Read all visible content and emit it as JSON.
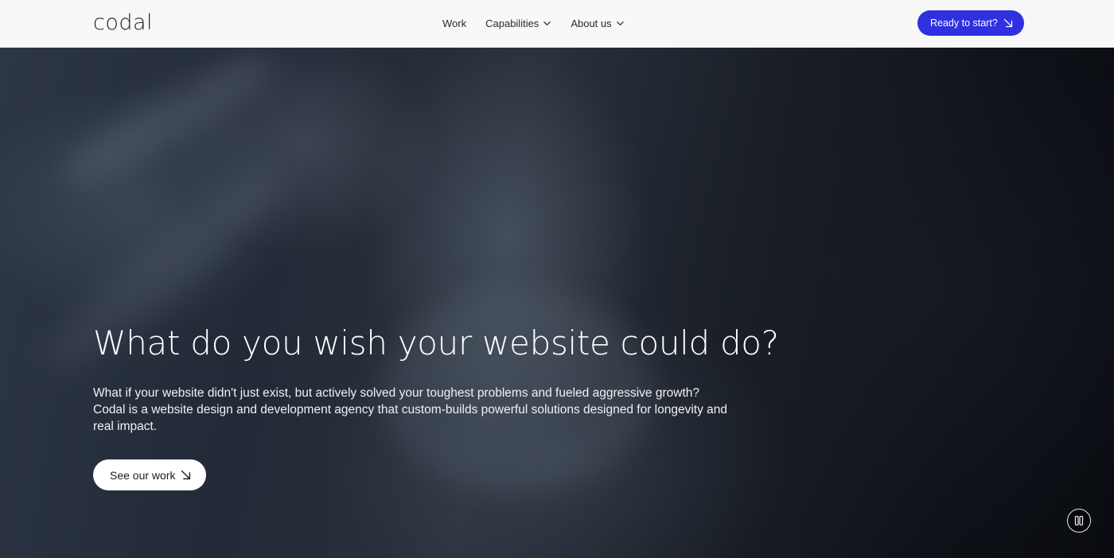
{
  "header": {
    "logo": "codal",
    "nav": [
      {
        "label": "Work",
        "has_dropdown": false
      },
      {
        "label": "Capabilities",
        "has_dropdown": true
      },
      {
        "label": "About us",
        "has_dropdown": true
      }
    ],
    "cta_label": "Ready to start?",
    "cta_color": "#2f30e0"
  },
  "hero": {
    "headline": "What do you wish your website could do?",
    "description": "What if your website didn't just exist, but actively solved your toughest problems and fueled aggressive growth? Codal is a website design and development agency that custom-builds powerful solutions designed for longevity and real impact.",
    "button_label": "See our work",
    "video_control": "pause-icon"
  },
  "icons": {
    "nav_dropdown": "chevron-down-icon",
    "cta_arrow": "arrow-down-right-icon",
    "button_arrow": "arrow-down-right-icon"
  }
}
